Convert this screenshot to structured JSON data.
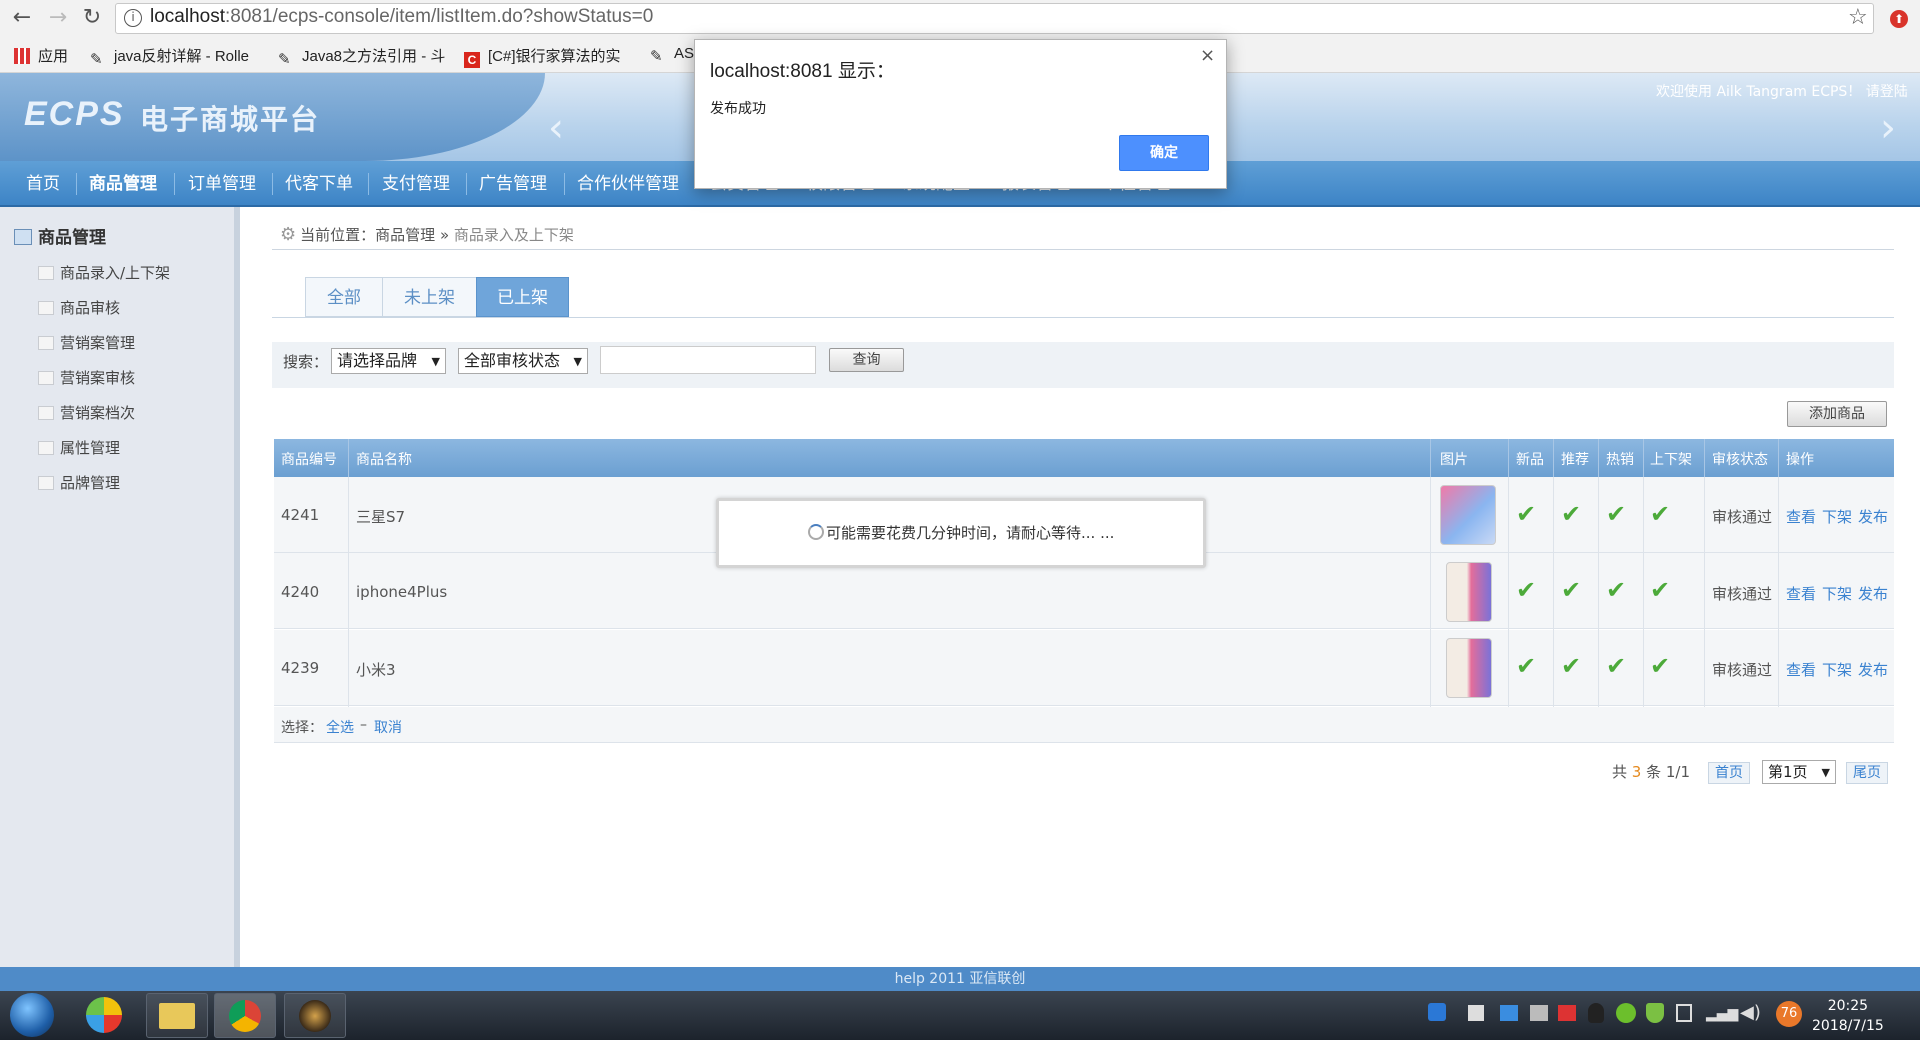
{
  "browser": {
    "url_host": "localhost",
    "url_rest": ":8081/ecps-console/item/listItem.do?showStatus=0",
    "bookmarks": [
      "应用",
      "java反射详解 - Rolle",
      "Java8之方法引用 - 斗",
      "[C#]银行家算法的实",
      "AS"
    ]
  },
  "header": {
    "logo": "ECPS",
    "logo_cn": "电子商城平台",
    "welcome": "欢迎使用 Ailk Tangram ECPS！  请登陆"
  },
  "nav": [
    "首页",
    "商品管理",
    "订单管理",
    "代客下单",
    "支付管理",
    "广告管理",
    "合作伙伴管理",
    "会员管理",
    "权限管理",
    "系统配置",
    "报表管理",
    "个性管理"
  ],
  "sidebar": {
    "title": "商品管理",
    "items": [
      "商品录入/上下架",
      "商品审核",
      "营销案管理",
      "营销案审核",
      "营销案档次",
      "属性管理",
      "品牌管理"
    ]
  },
  "breadcrumb": {
    "label": "当前位置：",
    "section": "商品管理",
    "sep": "»",
    "current": "商品录入及上下架"
  },
  "tabs": [
    "全部",
    "未上架",
    "已上架"
  ],
  "search": {
    "label": "搜索：",
    "brand": "请选择品牌",
    "status": "全部审核状态",
    "query_button": "查询"
  },
  "add_button": "添加商品",
  "table": {
    "headers": [
      "商品编号",
      "商品名称",
      "图片",
      "新品",
      "推荐",
      "热销",
      "上下架",
      "审核状态",
      "操作"
    ],
    "rows": [
      {
        "id": "4241",
        "name": "三星S7",
        "status": "审核通过"
      },
      {
        "id": "4240",
        "name": "iphone4Plus",
        "status": "审核通过"
      },
      {
        "id": "4239",
        "name": "小米3",
        "status": "审核通过"
      }
    ],
    "actions": [
      "查看",
      "下架",
      "发布"
    ],
    "check": "✔"
  },
  "select_row": {
    "label": "选择：",
    "all": "全选",
    "dash": "–",
    "cancel": "取消"
  },
  "pager": {
    "total_prefix": "共",
    "total": "3",
    "total_suffix": "条 1/1",
    "first": "首页",
    "page": "第1页",
    "last": "尾页"
  },
  "footer": "help 2011 亚信联创",
  "taskbar": {
    "time": "20:25",
    "date": "2018/7/15",
    "badge": "76"
  },
  "alert": {
    "title": "localhost:8081 显示：",
    "message": "发布成功",
    "ok": "确定",
    "close": "×"
  },
  "loading": {
    "text": "可能需要花费几分钟时间，请耐心等待... ..."
  }
}
